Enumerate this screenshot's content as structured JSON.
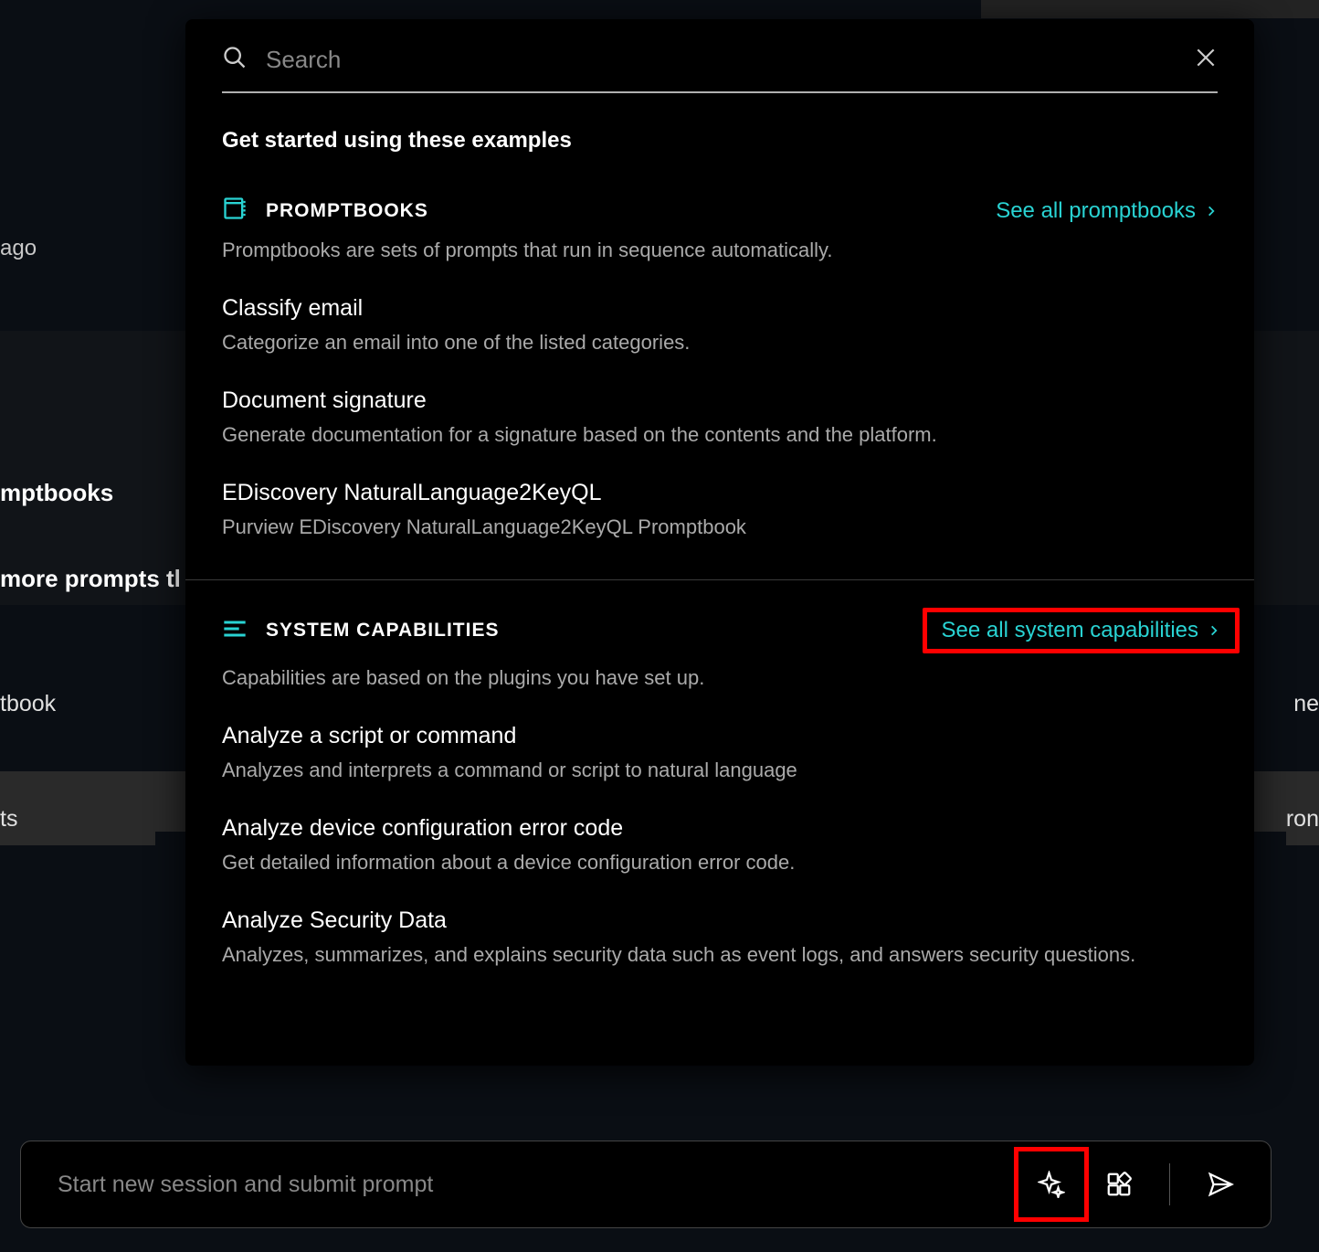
{
  "background": {
    "ago": "ago",
    "mptbooks": "mptbooks",
    "moreprompts": " more prompts tl",
    "tbook": "tbook",
    "ts": "ts",
    "ron": "ron",
    "ne": "ne"
  },
  "popup": {
    "search_placeholder": "Search",
    "subtitle": "Get started using these examples",
    "promptbooks": {
      "title": "PROMPTBOOKS",
      "see_all": "See all promptbooks",
      "desc": "Promptbooks are sets of prompts that run in sequence automatically.",
      "items": [
        {
          "title": "Classify email",
          "desc": "Categorize an email into one of the listed categories."
        },
        {
          "title": "Document signature",
          "desc": "Generate documentation for a signature based on the contents and the platform."
        },
        {
          "title": "EDiscovery NaturalLanguage2KeyQL",
          "desc": "Purview EDiscovery NaturalLanguage2KeyQL Promptbook"
        }
      ]
    },
    "syscap": {
      "title": "SYSTEM CAPABILITIES",
      "see_all": "See all system capabilities",
      "desc": "Capabilities are based on the plugins you have set up.",
      "items": [
        {
          "title": "Analyze a script or command",
          "desc": "Analyzes and interprets a command or script to natural language"
        },
        {
          "title": "Analyze device configuration error code",
          "desc": "Get detailed information about a device configuration error code."
        },
        {
          "title": "Analyze Security Data",
          "desc": "Analyzes, summarizes, and explains security data such as event logs, and answers security questions."
        }
      ]
    }
  },
  "prompt_bar": {
    "placeholder": "Start new session and submit prompt"
  },
  "colors": {
    "accent": "#29d3d3",
    "highlight": "#ff0000"
  }
}
